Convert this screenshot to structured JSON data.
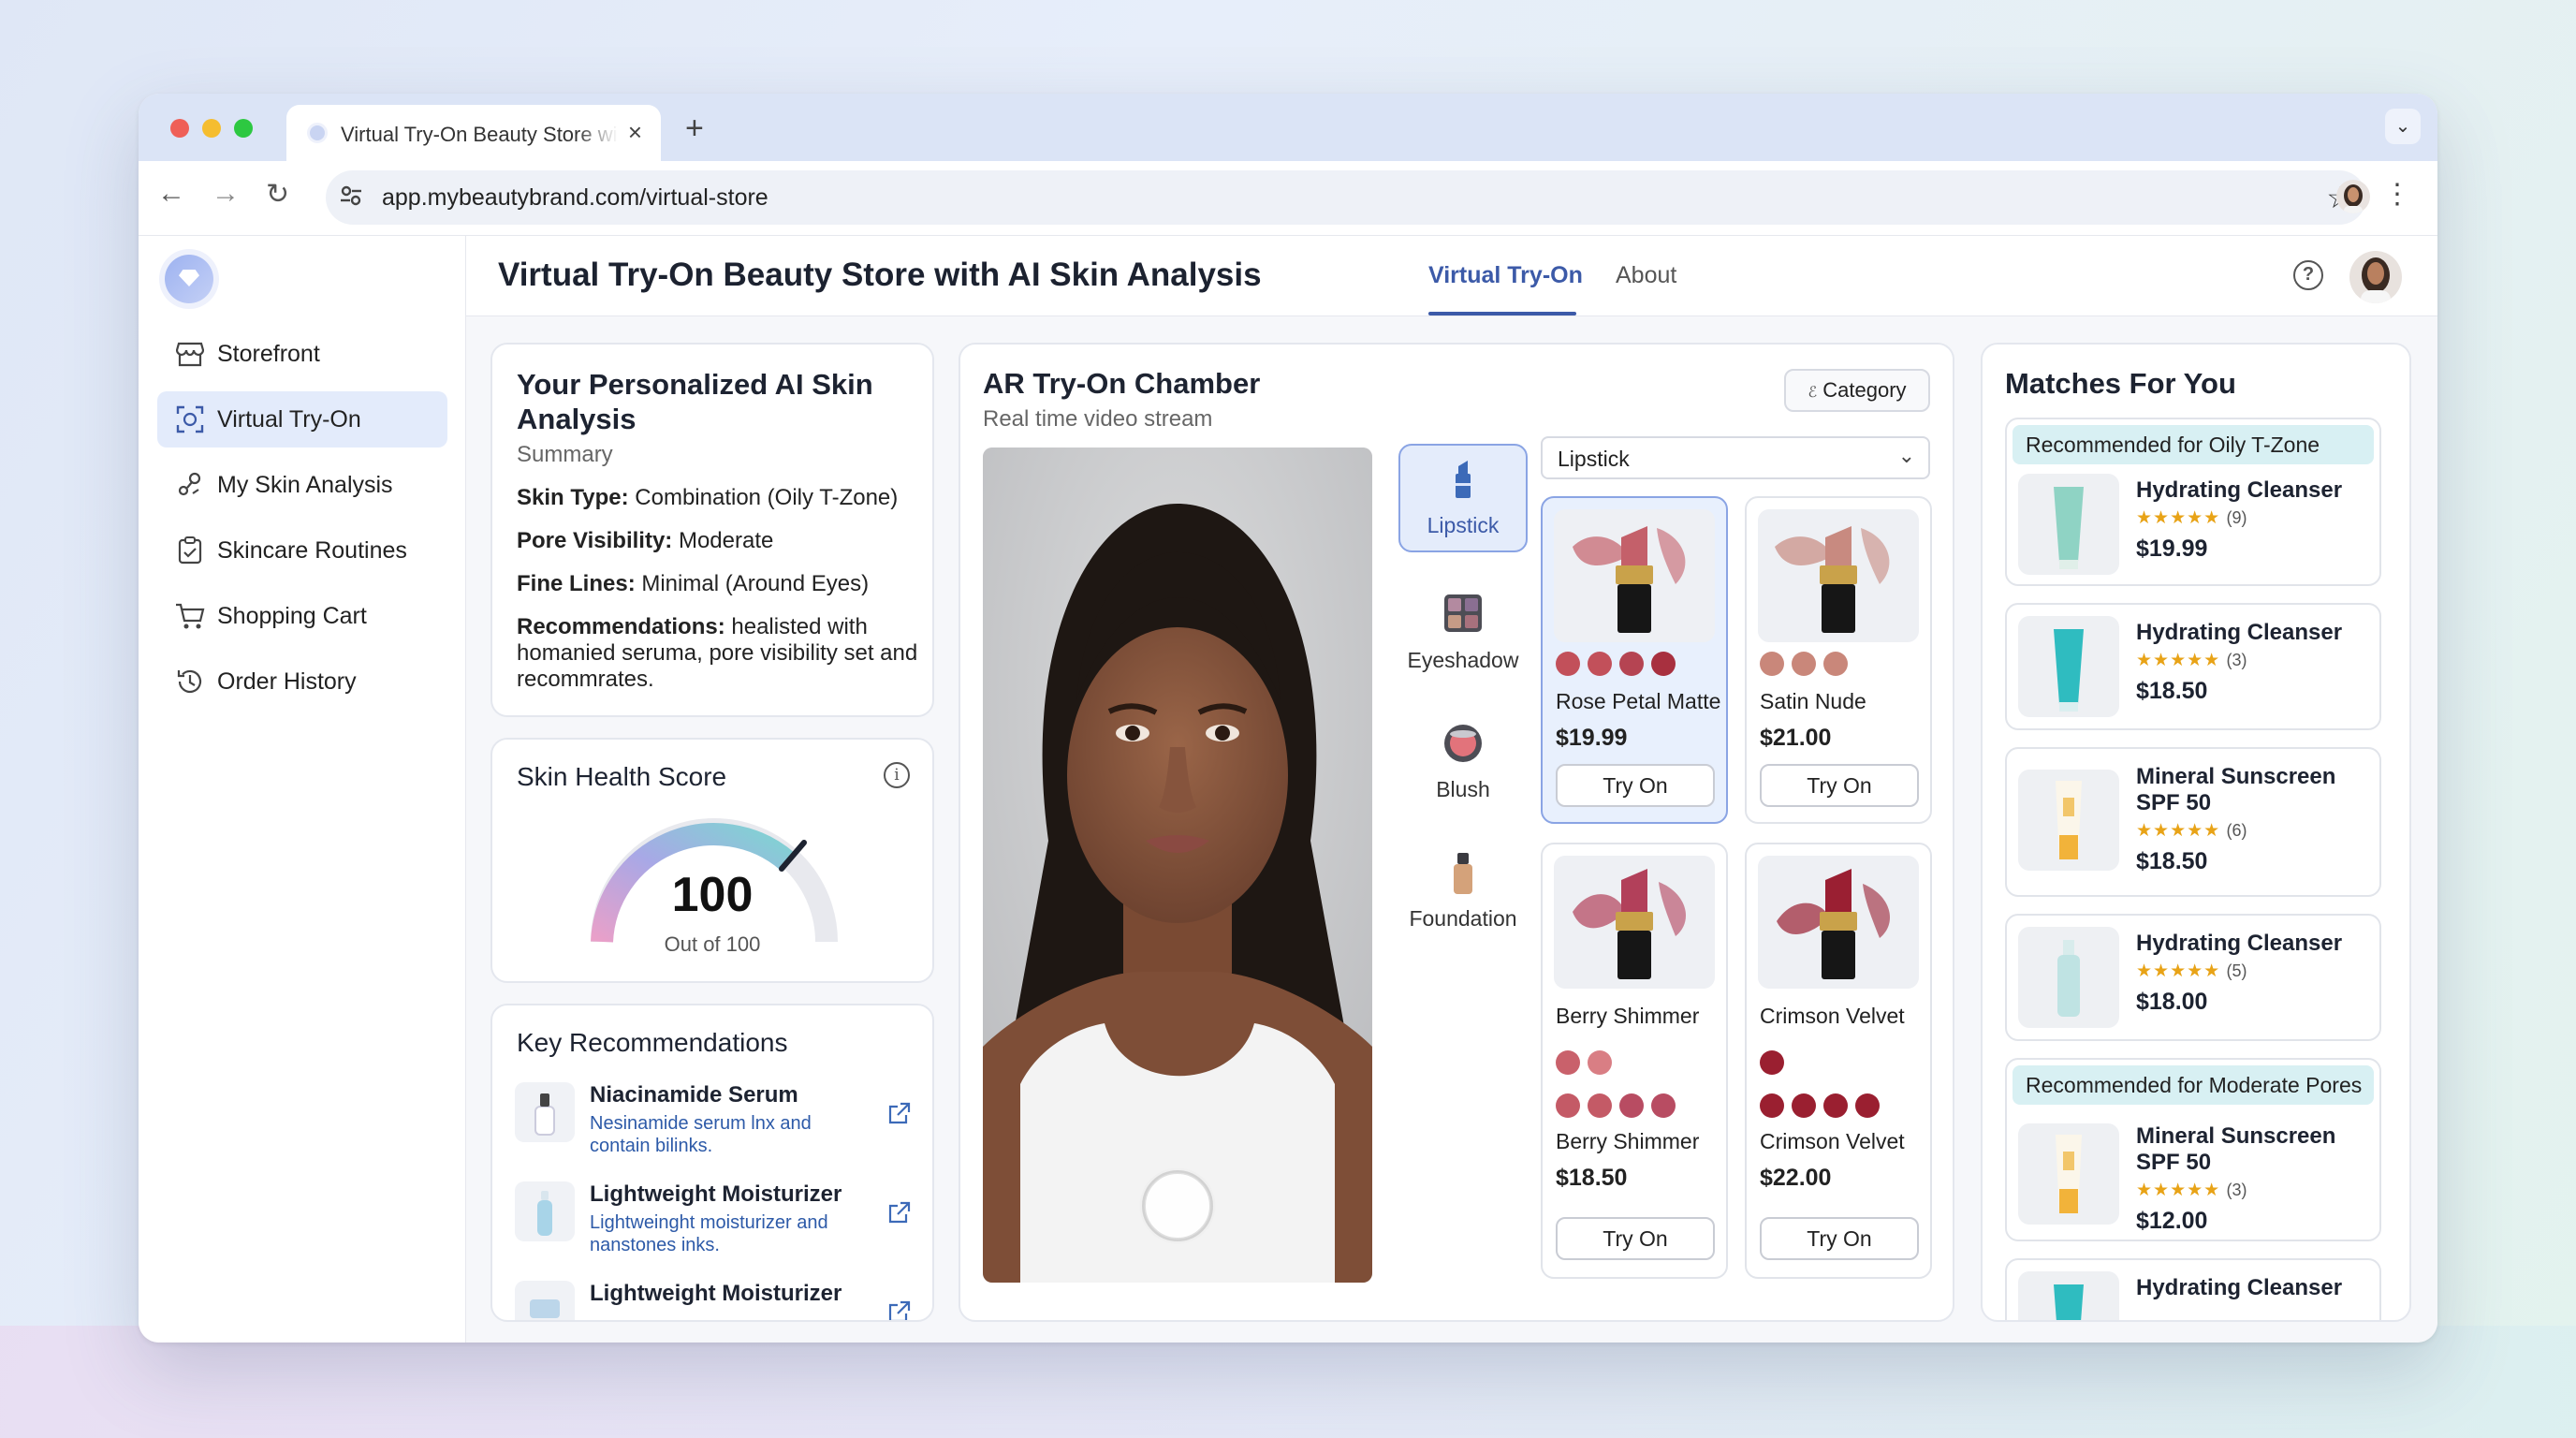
{
  "browser": {
    "tab_title": "Virtual Try-On Beauty Store with AI Skin Analysis",
    "new_tab": "+",
    "url": "app.mybeautybrand.com/virtual-store"
  },
  "sidebar": {
    "items": [
      {
        "label": "Storefront",
        "icon": "storefront-icon"
      },
      {
        "label": "Virtual Try-On",
        "icon": "scan-face-icon",
        "active": true
      },
      {
        "label": "My Skin Analysis",
        "icon": "skin-analysis-icon"
      },
      {
        "label": "Skincare Routines",
        "icon": "clipboard-check-icon"
      },
      {
        "label": "Shopping Cart",
        "icon": "cart-icon"
      },
      {
        "label": "Order History",
        "icon": "history-icon"
      }
    ]
  },
  "header": {
    "title": "Virtual Try-On Beauty Store with AI Skin Analysis",
    "tabs": [
      "Virtual Try-On",
      "About"
    ],
    "active_tab": "Virtual Try-On",
    "accent": "#3c5aa8"
  },
  "analysis": {
    "title": "Your Personalized AI Skin Analysis",
    "subtitle": "Summary",
    "rows": [
      {
        "label": "Skin Type",
        "value": "Combination (Oily T-Zone)"
      },
      {
        "label": "Pore Visibility",
        "value": "Moderate"
      },
      {
        "label": "Fine Lines",
        "value": "Minimal (Around Eyes)"
      }
    ],
    "rec_label": "Recommendations:",
    "rec_text": "healisted with homanied seruma, pore visibility set and recommrates."
  },
  "score": {
    "title": "Skin Health Score",
    "value": "100",
    "caption": "Out of 100",
    "level": 1.0
  },
  "key_recs": {
    "title": "Key Recommendations",
    "items": [
      {
        "name": "Niacinamide Serum",
        "desc": "Nesinamide serum lnx and contain bilinks."
      },
      {
        "name": "Lightweight Moisturizer",
        "desc": "Lightweinght moisturizer and nanstones inks."
      },
      {
        "name": "Lightweight Moisturizer",
        "desc": ""
      }
    ]
  },
  "chamber": {
    "title": "AR Try-On Chamber",
    "subtitle": "Real time video stream",
    "category_button": "Category",
    "categories": [
      "Lipstick",
      "Eyeshadow",
      "Blush",
      "Foundation"
    ],
    "active_category": "Lipstick",
    "dropdown_value": "Lipstick",
    "try_on_label": "Try On",
    "products": [
      {
        "name": "Rose Petal Matte",
        "price": "$19.99",
        "selected": true,
        "swatches": [
          "#c2505a",
          "#c2505a",
          "#b54452",
          "#a8303f"
        ],
        "color": "#c4606a"
      },
      {
        "name": "Satin Nude",
        "price": "$21.00",
        "swatches": [
          "#c9877a",
          "#c9877a",
          "#c9877a"
        ],
        "color": "#c88a80"
      },
      {
        "name": "Berry Shimmer",
        "name2": "Berry Shimmer",
        "price": "$18.50",
        "swatches_top": [
          "#c9616b",
          "#d97e84"
        ],
        "swatches": [
          "#c45a66",
          "#c45a66",
          "#b84c62",
          "#b84c62"
        ],
        "color": "#b2405a"
      },
      {
        "name": "Crimson Velvet",
        "name2": "Crimson Velvet",
        "price": "$22.00",
        "swatches_top": [
          "#9a1f30"
        ],
        "swatches": [
          "#9a1f30",
          "#9a1f30",
          "#9a1f30",
          "#9a1f30"
        ],
        "color": "#9a1f32"
      }
    ]
  },
  "matches": {
    "title": "Matches For You",
    "groups": [
      {
        "header": "Recommended for Oily T-Zone",
        "items": [
          {
            "name": "Hydrating Cleanser",
            "rating": "(9)",
            "price": "$19.99"
          }
        ]
      },
      {
        "header": "",
        "items": [
          {
            "name": "Hydrating Cleanser",
            "rating": "(3)",
            "price": "$18.50"
          }
        ]
      },
      {
        "header": "",
        "items": [
          {
            "name": "Mineral Sunscreen SPF 50",
            "rating": "(6)",
            "price": "$18.50"
          }
        ]
      },
      {
        "header": "",
        "items": [
          {
            "name": "Hydrating Cleanser",
            "rating": "(5)",
            "price": "$18.00"
          }
        ]
      },
      {
        "header": "Recommended for Moderate Pores",
        "items": [
          {
            "name": "Mineral Sunscreen SPF 50",
            "rating": "(3)",
            "price": "$12.00"
          }
        ]
      },
      {
        "header": "",
        "items": [
          {
            "name": "Hydrating Cleanser",
            "rating": "",
            "price": ""
          }
        ]
      }
    ]
  }
}
